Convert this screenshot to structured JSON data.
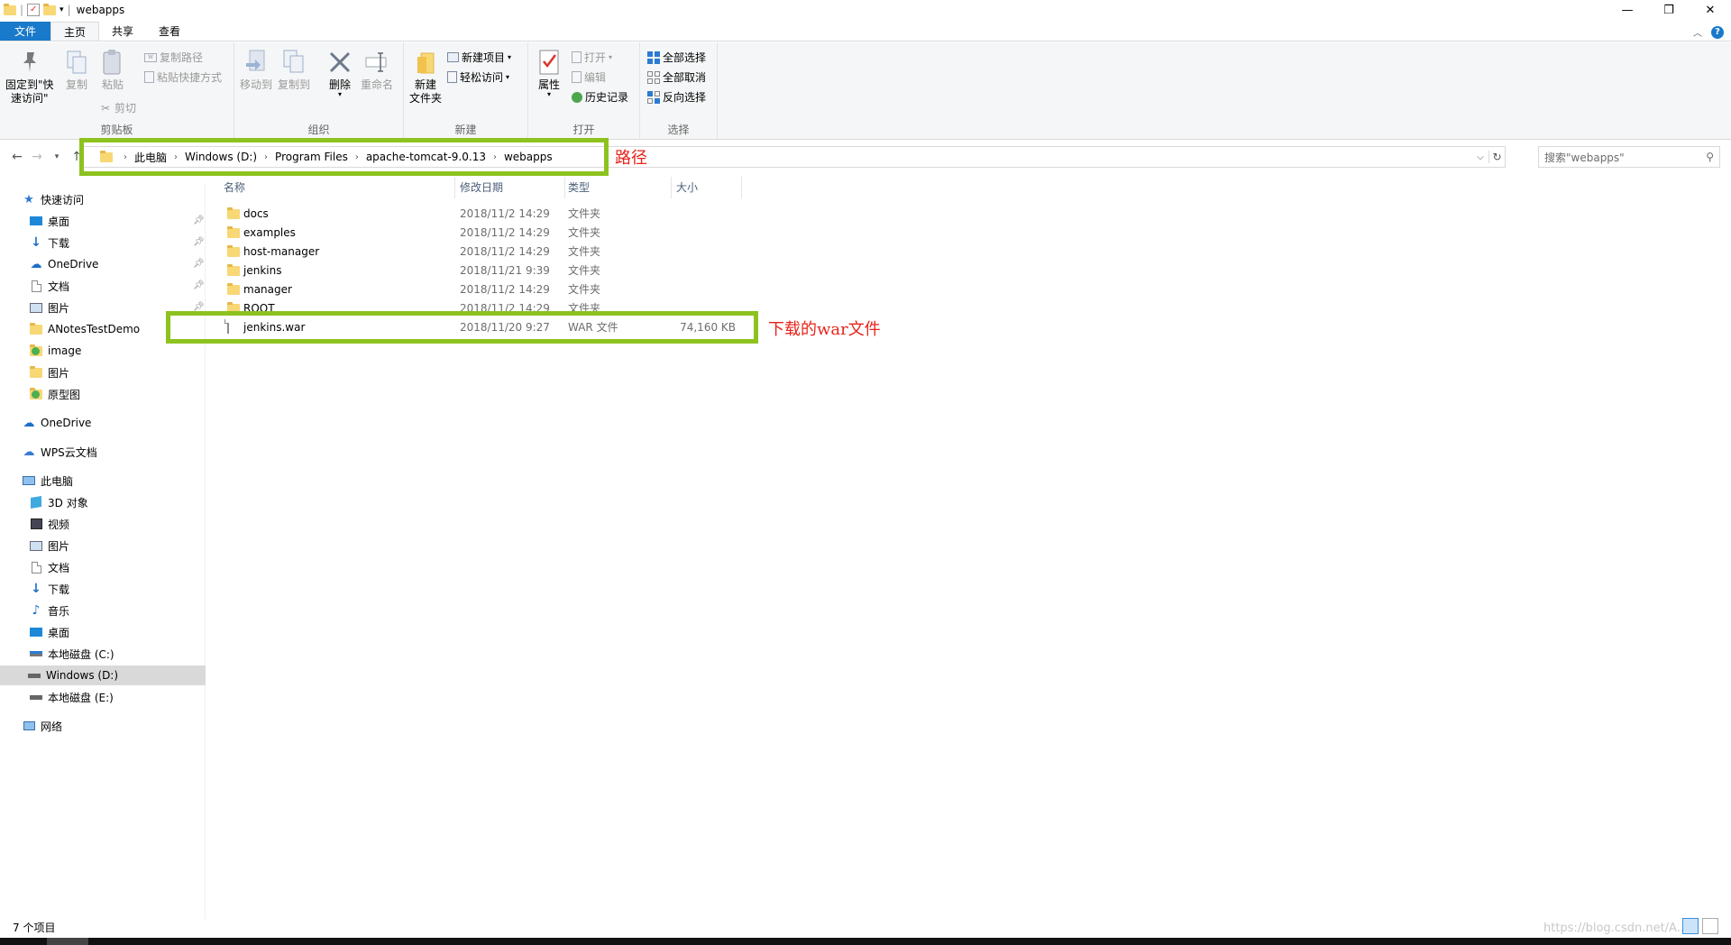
{
  "window": {
    "title": "webapps",
    "quick_access_separator": "|",
    "controls": [
      "—",
      "❐",
      "✕"
    ]
  },
  "tabs": [
    {
      "label": "文件"
    },
    {
      "label": "主页"
    },
    {
      "label": "共享"
    },
    {
      "label": "查看"
    }
  ],
  "ribbon": {
    "clipboard": {
      "label": "剪贴板",
      "pin_label_1": "固定到\"快",
      "pin_label_2": "速访问\"",
      "copy": "复制",
      "paste": "粘贴",
      "copy_path": "复制路径",
      "paste_shortcut": "粘贴快捷方式",
      "cut": "剪切"
    },
    "organize": {
      "label": "组织",
      "move_to": "移动到",
      "copy_to": "复制到",
      "delete": "删除",
      "rename": "重命名"
    },
    "new": {
      "label": "新建",
      "new_folder_1": "新建",
      "new_folder_2": "文件夹",
      "new_item": "新建项目",
      "easy_access": "轻松访问"
    },
    "open": {
      "label": "打开",
      "properties": "属性",
      "open": "打开",
      "edit": "编辑",
      "history": "历史记录"
    },
    "select": {
      "label": "选择",
      "select_all": "全部选择",
      "select_none": "全部取消",
      "invert": "反向选择"
    }
  },
  "address": {
    "crumbs": [
      "此电脑",
      "Windows (D:)",
      "Program Files",
      "apache-tomcat-9.0.13",
      "webapps"
    ],
    "search_placeholder": "搜索\"webapps\""
  },
  "annotations": {
    "path_label": "路径",
    "war_label": "下载的war文件",
    "highlight_color": "#8dc21f",
    "text_color": "#e8231a"
  },
  "nav": {
    "quick_access": "快速访问",
    "quick_items": [
      "桌面",
      "下载",
      "OneDrive",
      "文档",
      "图片",
      "ANotesTestDemo",
      "image",
      "图片",
      "原型图"
    ],
    "onedrive": "OneDrive",
    "wps": "WPS云文档",
    "this_pc": "此电脑",
    "pc_items": [
      "3D 对象",
      "视频",
      "图片",
      "文档",
      "下载",
      "音乐",
      "桌面",
      "本地磁盘 (C:)",
      "Windows (D:)",
      "本地磁盘 (E:)"
    ],
    "network": "网络"
  },
  "columns": {
    "name": "名称",
    "date": "修改日期",
    "type": "类型",
    "size": "大小"
  },
  "files": [
    {
      "name": "docs",
      "date": "2018/11/2 14:29",
      "type": "文件夹",
      "size": "",
      "icon": "folder-icon"
    },
    {
      "name": "examples",
      "date": "2018/11/2 14:29",
      "type": "文件夹",
      "size": "",
      "icon": "folder-icon"
    },
    {
      "name": "host-manager",
      "date": "2018/11/2 14:29",
      "type": "文件夹",
      "size": "",
      "icon": "folder-icon"
    },
    {
      "name": "jenkins",
      "date": "2018/11/21 9:39",
      "type": "文件夹",
      "size": "",
      "icon": "folder-icon"
    },
    {
      "name": "manager",
      "date": "2018/11/2 14:29",
      "type": "文件夹",
      "size": "",
      "icon": "folder-icon"
    },
    {
      "name": "ROOT",
      "date": "2018/11/2 14:29",
      "type": "文件夹",
      "size": "",
      "icon": "folder-icon"
    },
    {
      "name": "jenkins.war",
      "date": "2018/11/20 9:27",
      "type": "WAR 文件",
      "size": "74,160 KB",
      "icon": "file-icon"
    }
  ],
  "status": {
    "count": "7 个项目"
  },
  "watermark": "https://blog.csdn.net/A..."
}
